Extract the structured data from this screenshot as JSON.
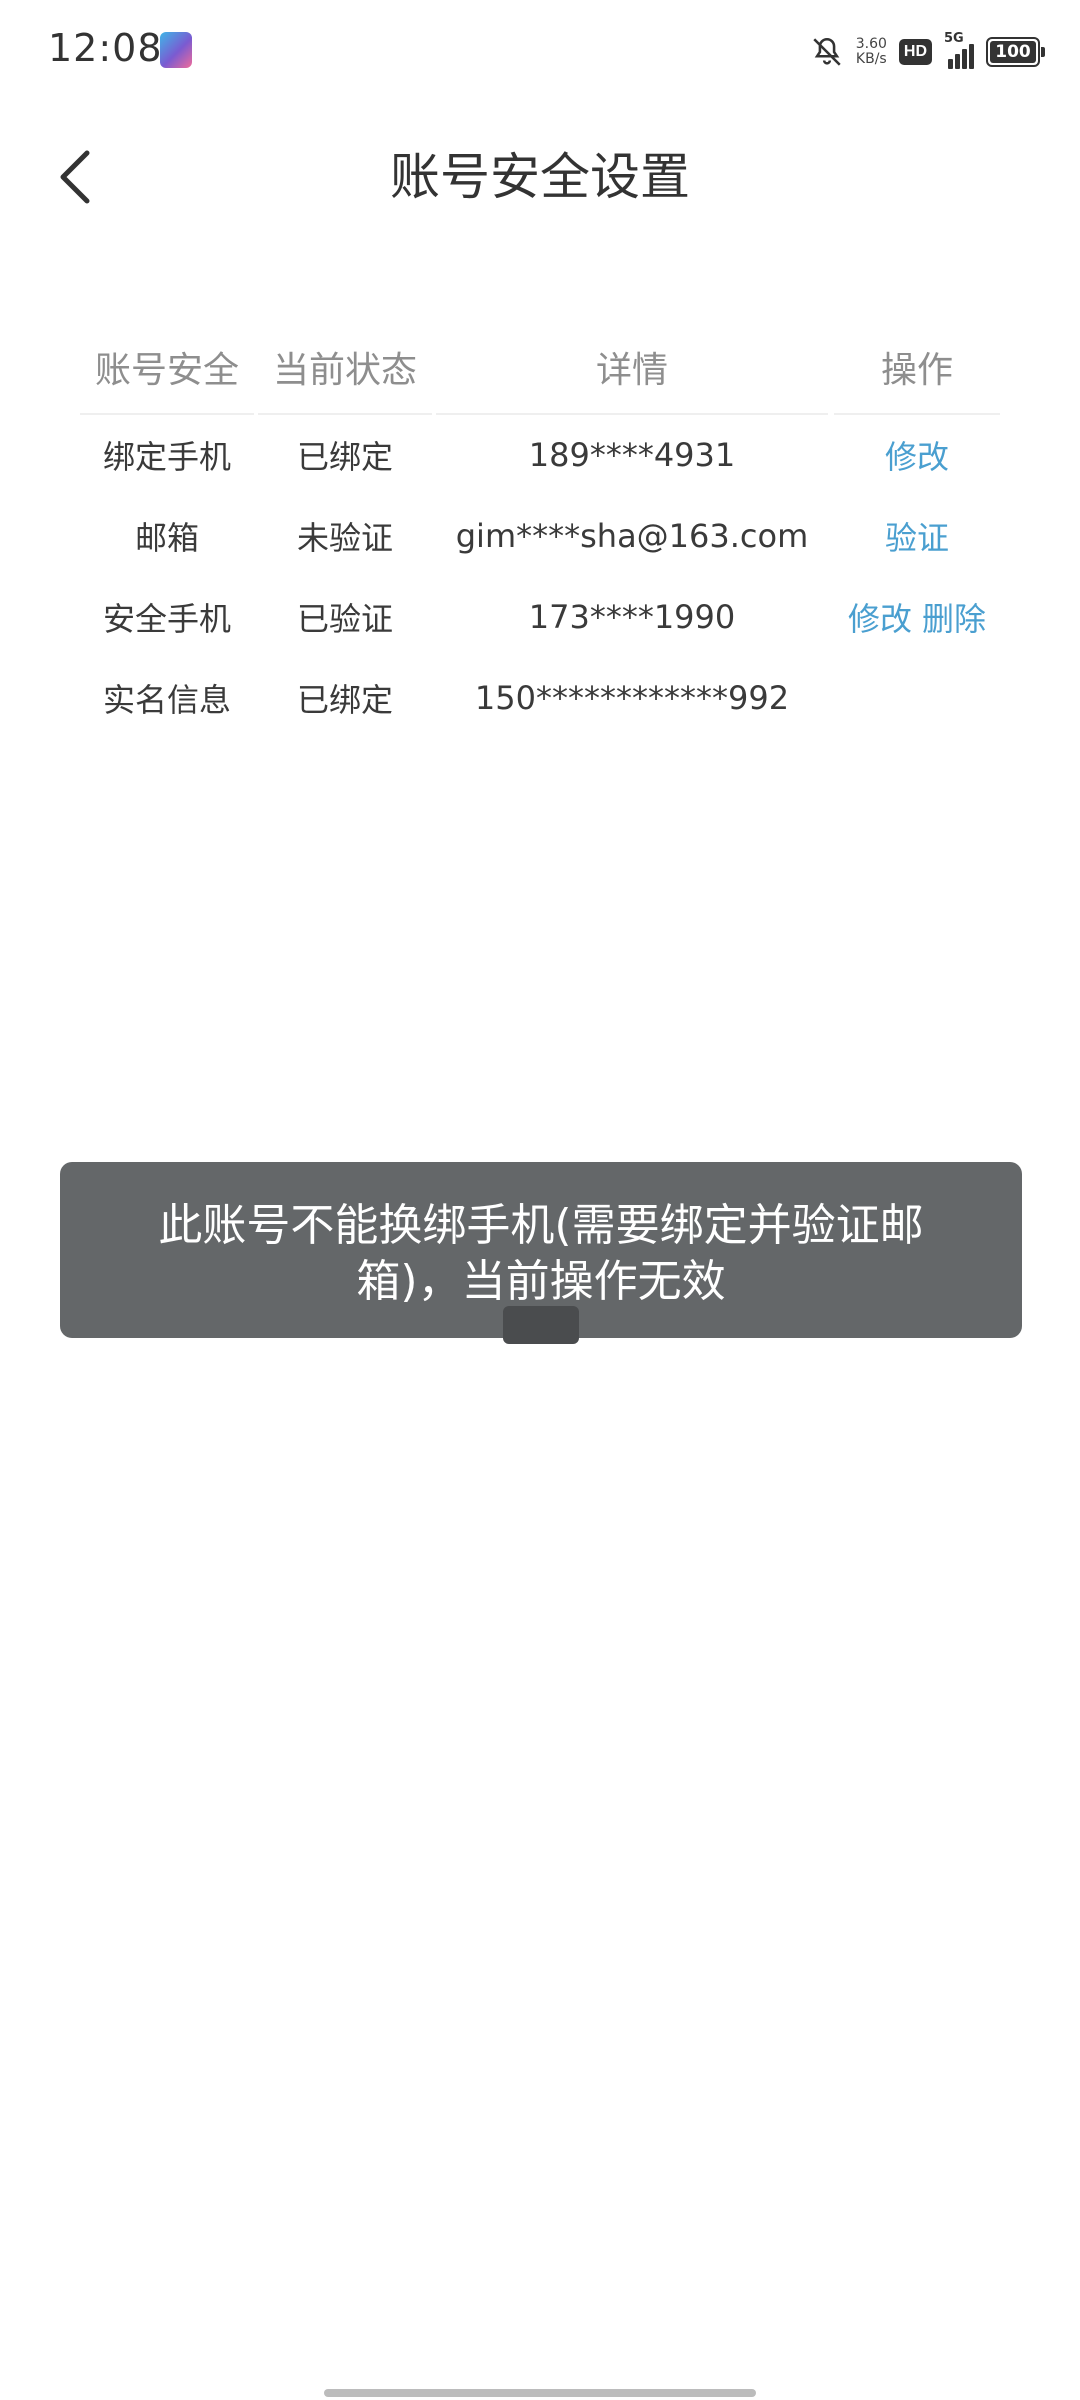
{
  "status_bar": {
    "time": "12:08",
    "net_speed_value": "3.60",
    "net_speed_unit": "KB/s",
    "hd_label": "HD",
    "network_label": "5G",
    "battery_level": "100",
    "icons": [
      "app-icon",
      "bell-off-icon",
      "hd-badge",
      "signal-icon",
      "battery-icon"
    ]
  },
  "header": {
    "title": "账号安全设置",
    "back_icon": "chevron-left-icon"
  },
  "table": {
    "headers": [
      "账号安全",
      "当前状态",
      "详情",
      "操作"
    ],
    "rows": [
      {
        "item": "绑定手机",
        "status": "已绑定",
        "detail": "189****4931",
        "actions": [
          "修改"
        ]
      },
      {
        "item": "邮箱",
        "status": "未验证",
        "detail": "gim****sha@163.com",
        "actions": [
          "验证"
        ]
      },
      {
        "item": "安全手机",
        "status": "已验证",
        "detail": "173****1990",
        "actions": [
          "修改",
          "删除"
        ]
      },
      {
        "item": "实名信息",
        "status": "已绑定",
        "detail": "150************992",
        "actions": []
      }
    ]
  },
  "toast": {
    "line1": "此账号不能换绑手机(需要绑定并验证邮",
    "line2": "箱)，当前操作无效"
  },
  "colors": {
    "link": "#4a9fd0",
    "header_text": "#8e8e8e",
    "toast_bg": "#646769"
  }
}
